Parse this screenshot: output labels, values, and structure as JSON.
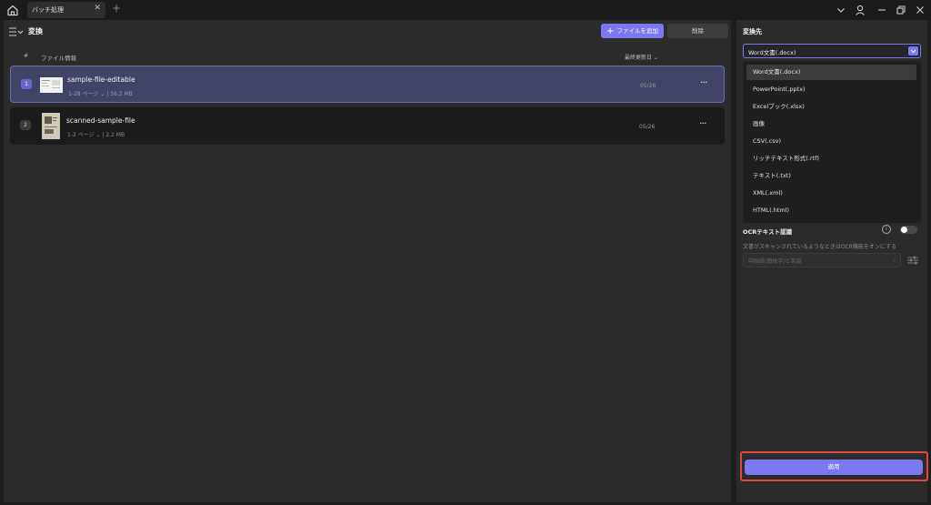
{
  "titlebar": {
    "tab_label": "バッチ処理",
    "tab_close": "✕",
    "tab_add": "+"
  },
  "main": {
    "title": "変換",
    "add_button": "ファイルを追加",
    "add_button_icon": "+",
    "delete_button": "削除",
    "columns": {
      "index": "#",
      "info": "ファイル情報",
      "date": "最終更新日 ⌄"
    },
    "files": [
      {
        "num": "1",
        "name": "sample-file-editable",
        "meta": "1-28 ページ ⌄ | 16.2 MB",
        "date": "05/26",
        "more": "···"
      },
      {
        "num": "2",
        "name": "scanned-sample-file",
        "meta": "1-2 ページ ⌄ | 2.2 MB",
        "date": "05/26",
        "more": "···"
      }
    ]
  },
  "side": {
    "title": "変換先",
    "format_selected": "Word文書(.docx)",
    "format_options": [
      "Word文書(.docx)",
      "PowerPoint(.pptx)",
      "Excelブック(.xlsx)",
      "画像",
      "CSV(.csv)",
      "リッチテキスト形式(.rtf)",
      "テキスト(.txt)",
      "XML(.xml)",
      "HTML(.html)"
    ],
    "ocr_label": "OCRテキスト認識",
    "ocr_enabled": false,
    "ocr_description": "文書がスキャンされているようなときはOCR機能をオンにする",
    "ocr_language": "中国語(簡体字)と英語",
    "apply_button": "適用"
  },
  "colors": {
    "accent": "#7b78f2",
    "highlight_frame": "#e14545",
    "selected_row": "#424466"
  }
}
